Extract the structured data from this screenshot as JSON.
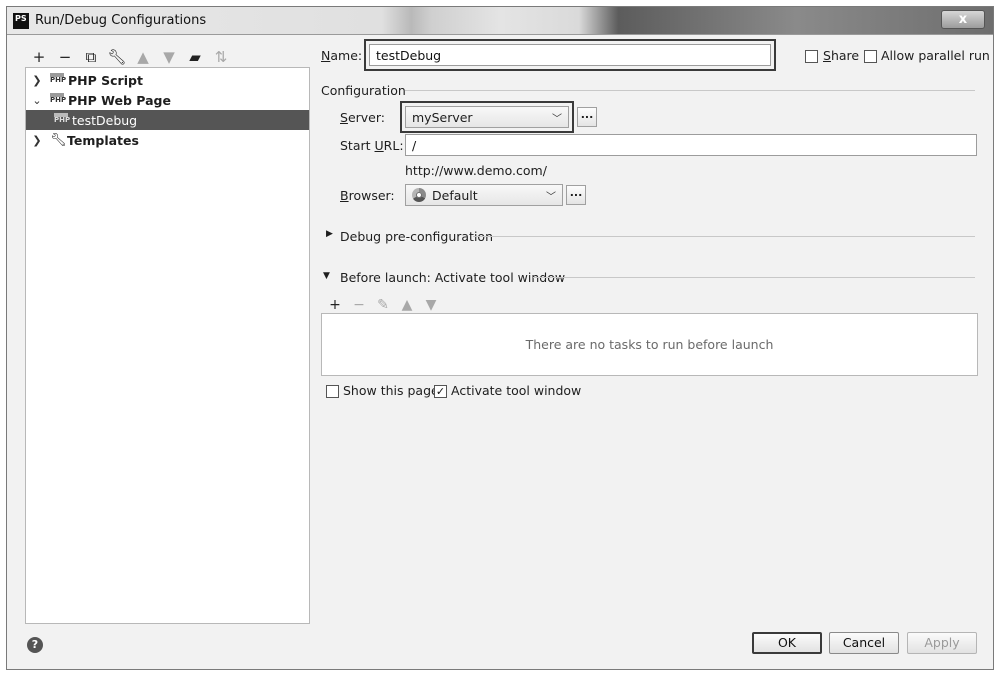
{
  "window": {
    "logo": "PS",
    "title": "Run/Debug Configurations",
    "close_label": "x"
  },
  "left_toolbar": {
    "icons": [
      "add-icon",
      "remove-icon",
      "copy-icon",
      "wrench-icon",
      "move-up-icon",
      "move-down-icon",
      "folder-icon",
      "sort-icon"
    ]
  },
  "tree": {
    "items": [
      {
        "label": "PHP Script",
        "expanded": false,
        "icon": "php-icon"
      },
      {
        "label": "PHP Web Page",
        "expanded": true,
        "icon": "php-icon"
      },
      {
        "label": "testDebug",
        "selected": true,
        "icon": "php-icon"
      },
      {
        "label": "Templates",
        "expanded": false,
        "icon": "wrench-icon"
      }
    ]
  },
  "form": {
    "name_label": "Name:",
    "name_value": "testDebug",
    "share_label": "Share",
    "share_checked": false,
    "parallel_label": "Allow parallel run",
    "parallel_checked": false,
    "configuration_label": "Configuration",
    "server_label": "Server:",
    "server_value": "myServer",
    "start_url_label": "Start URL:",
    "start_url_value": "/",
    "url_hint": "http://www.demo.com/",
    "browser_label": "Browser:",
    "browser_value": "Default",
    "dots": "...",
    "debug_preconfig_label": "Debug pre-configuration",
    "before_launch_label": "Before launch: Activate tool window",
    "no_tasks_text": "There are no tasks to run before launch",
    "show_page_label": "Show this page",
    "show_page_checked": false,
    "activate_tool_label": "Activate tool window",
    "activate_tool_checked": true
  },
  "buttons": {
    "ok": "OK",
    "cancel": "Cancel",
    "apply": "Apply"
  },
  "help_icon": "?"
}
